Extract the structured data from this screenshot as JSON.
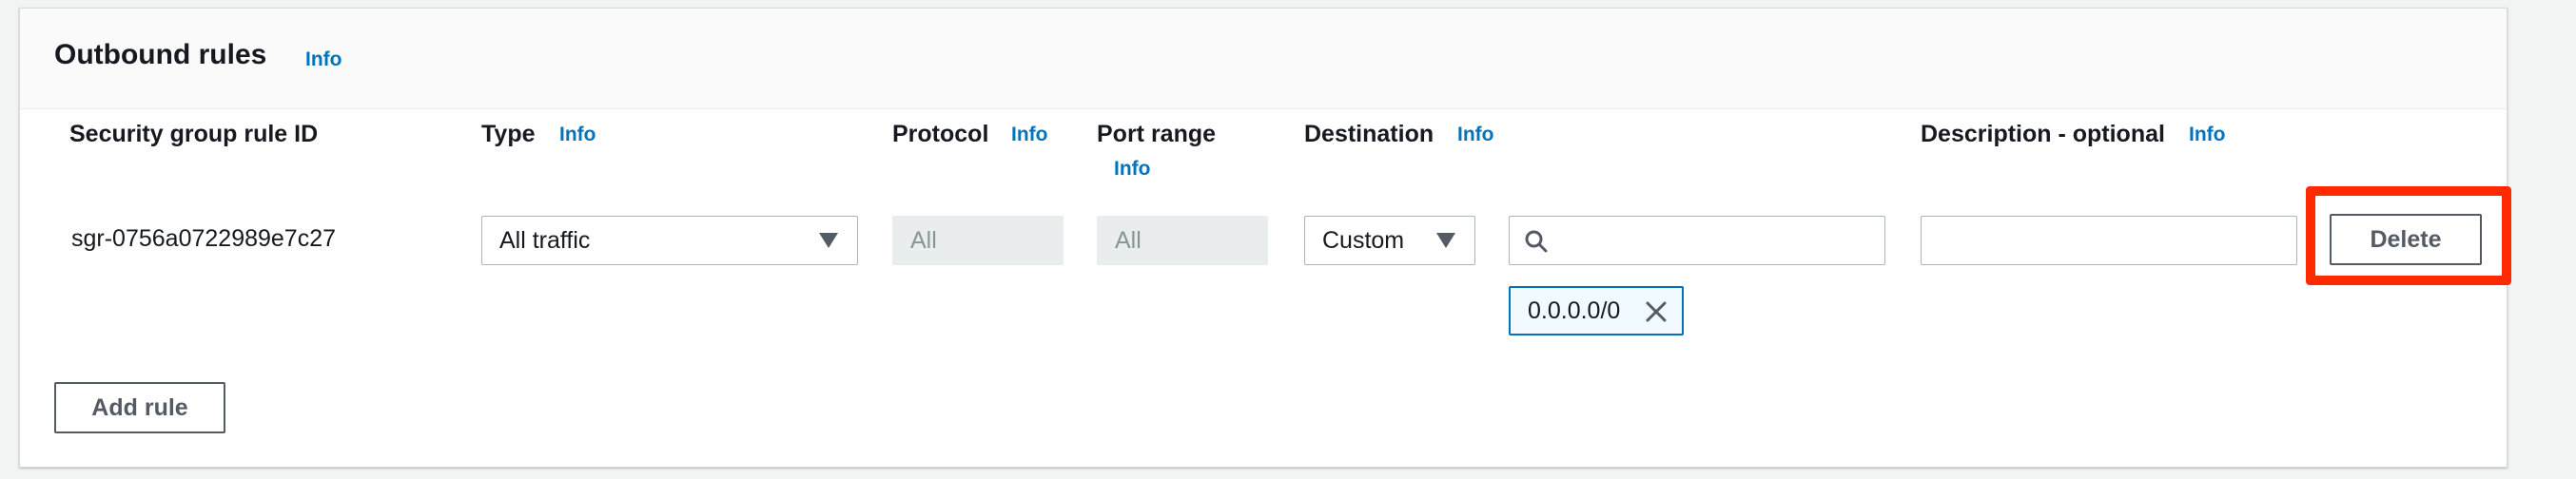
{
  "section": {
    "title": "Outbound rules",
    "info_label": "Info"
  },
  "columns": {
    "rule_id": "Security group rule ID",
    "type": "Type",
    "protocol": "Protocol",
    "port_range": "Port range",
    "destination": "Destination",
    "description": "Description - optional",
    "info_label": "Info"
  },
  "rule": {
    "id": "sgr-0756a0722989e7c27",
    "type_value": "All traffic",
    "protocol_value": "All",
    "port_range_value": "All",
    "destination_type": "Custom",
    "destination_search_value": "",
    "destination_token": "0.0.0.0/0",
    "description_value": "",
    "delete_label": "Delete"
  },
  "add_rule_label": "Add rule",
  "colors": {
    "info_link": "#0073bb",
    "highlight": "#ff2a00",
    "token_border": "#0073bb"
  },
  "icons": {
    "search": "search-icon",
    "remove": "close-icon",
    "caret": "caret-down-icon"
  }
}
